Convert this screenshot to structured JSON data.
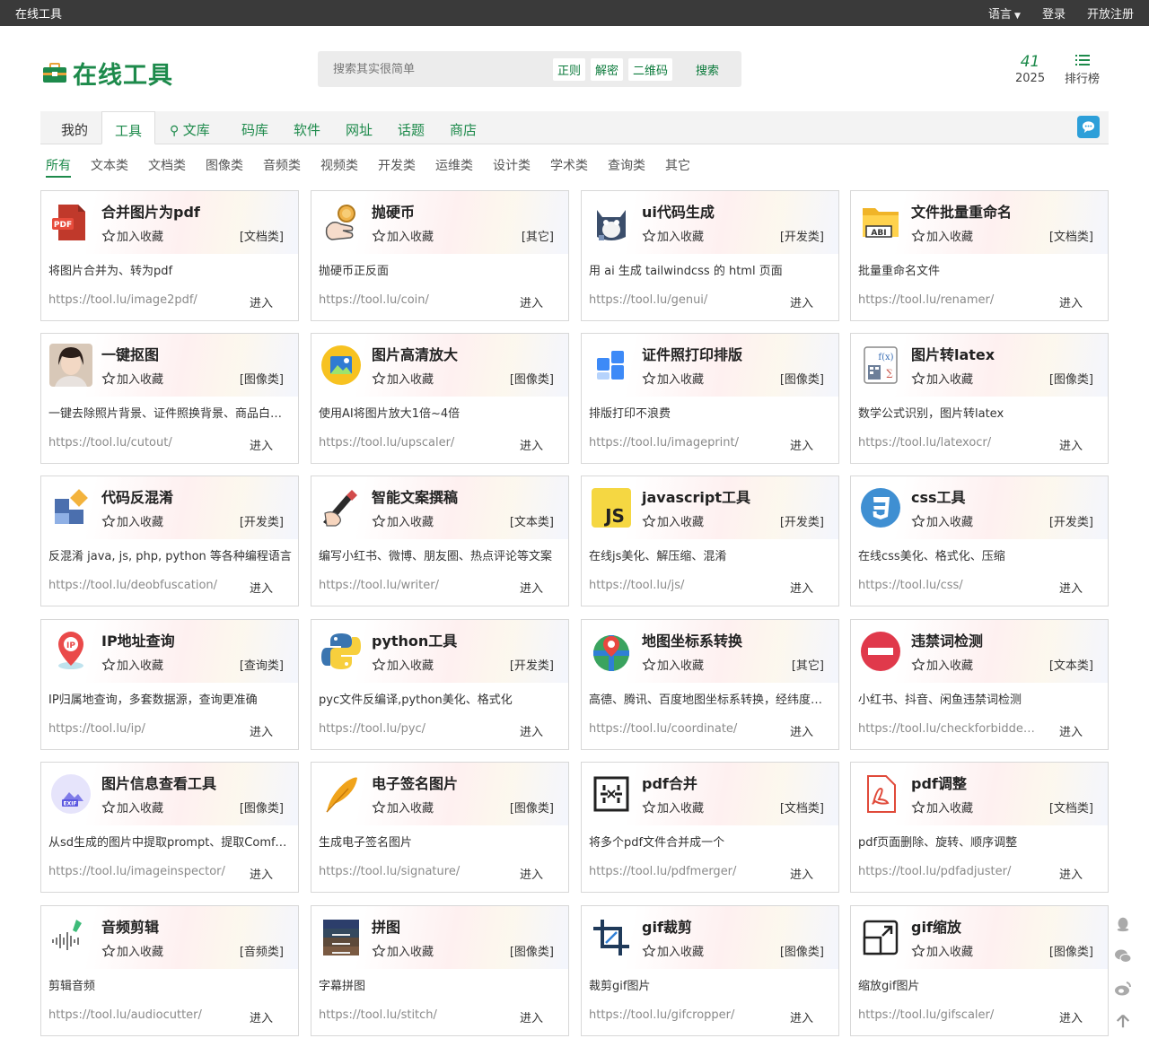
{
  "topbar": {
    "brand": "在线工具",
    "language": "语言",
    "login": "登录",
    "register": "开放注册"
  },
  "header": {
    "logo_text": "在线工具",
    "search_placeholder": "搜索其实很简单",
    "search_tags": [
      "正则",
      "解密",
      "二维码"
    ],
    "search_button": "搜索",
    "stat_count": "41",
    "stat_year": "2025",
    "rank_label": "排行榜"
  },
  "nav": {
    "tabs": [
      "我的",
      "工具",
      "文库",
      "码库",
      "软件",
      "网址",
      "话题",
      "商店"
    ],
    "active": "工具"
  },
  "categories": [
    "所有",
    "文本类",
    "文档类",
    "图像类",
    "音频类",
    "视频类",
    "开发类",
    "运维类",
    "设计类",
    "学术类",
    "查询类",
    "其它"
  ],
  "fav_label": "加入收藏",
  "enter_label": "进入",
  "tools": [
    {
      "name": "合并图片为pdf",
      "category": "[文档类]",
      "desc": "将图片合并为、转为pdf",
      "url": "https://tool.lu/image2pdf/",
      "icon": "pdf-red-icon"
    },
    {
      "name": "抛硬币",
      "category": "[其它]",
      "desc": "抛硬币正反面",
      "url": "https://tool.lu/coin/",
      "icon": "coin-flip-icon"
    },
    {
      "name": "ui代码生成",
      "category": "[开发类]",
      "desc": "用 ai 生成 tailwindcss 的 html 页面",
      "url": "https://tool.lu/genui/",
      "icon": "robot-cat-icon"
    },
    {
      "name": "文件批量重命名",
      "category": "[文档类]",
      "desc": "批量重命名文件",
      "url": "https://tool.lu/renamer/",
      "icon": "folder-rename-icon"
    },
    {
      "name": "一键抠图",
      "category": "[图像类]",
      "desc": "一键去除照片背景、证件照换背景、商品白底图",
      "url": "https://tool.lu/cutout/",
      "icon": "portrait-icon"
    },
    {
      "name": "图片高清放大",
      "category": "[图像类]",
      "desc": "使用AI将图片放大1倍~4倍",
      "url": "https://tool.lu/upscaler/",
      "icon": "image-upscale-icon"
    },
    {
      "name": "证件照打印排版",
      "category": "[图像类]",
      "desc": "排版打印不浪费",
      "url": "https://tool.lu/imageprint/",
      "icon": "blue-squares-icon"
    },
    {
      "name": "图片转latex",
      "category": "[图像类]",
      "desc": "数学公式识别，图片转latex",
      "url": "https://tool.lu/latexocr/",
      "icon": "formula-icon"
    },
    {
      "name": "代码反混淆",
      "category": "[开发类]",
      "desc": "反混淆 java, js, php, python 等各种编程语言",
      "url": "https://tool.lu/deobfuscation/",
      "icon": "puzzle-icon"
    },
    {
      "name": "智能文案撰稿",
      "category": "[文本类]",
      "desc": "编写小红书、微博、朋友圈、热点评论等文案",
      "url": "https://tool.lu/writer/",
      "icon": "pen-hand-icon"
    },
    {
      "name": "javascript工具",
      "category": "[开发类]",
      "desc": "在线js美化、解压缩、混淆",
      "url": "https://tool.lu/js/",
      "icon": "js-icon"
    },
    {
      "name": "css工具",
      "category": "[开发类]",
      "desc": "在线css美化、格式化、压缩",
      "url": "https://tool.lu/css/",
      "icon": "css3-icon"
    },
    {
      "name": "IP地址查询",
      "category": "[查询类]",
      "desc": "IP归属地查询，多套数据源，查询更准确",
      "url": "https://tool.lu/ip/",
      "icon": "ip-pin-icon"
    },
    {
      "name": "python工具",
      "category": "[开发类]",
      "desc": "pyc文件反编译,python美化、格式化",
      "url": "https://tool.lu/pyc/",
      "icon": "python-icon"
    },
    {
      "name": "地图坐标系转换",
      "category": "[其它]",
      "desc": "高德、腾讯、百度地图坐标系转换，经纬度转换",
      "url": "https://tool.lu/coordinate/",
      "icon": "map-pin-icon"
    },
    {
      "name": "违禁词检测",
      "category": "[文本类]",
      "desc": "小红书、抖音、闲鱼违禁词检测",
      "url": "https://tool.lu/checkforbiddenwords/",
      "icon": "forbidden-icon"
    },
    {
      "name": "图片信息查看工具",
      "category": "[图像类]",
      "desc": "从sd生成的图片中提取prompt、提取Comfyui工作流",
      "url": "https://tool.lu/imageinspector/",
      "icon": "exif-icon"
    },
    {
      "name": "电子签名图片",
      "category": "[图像类]",
      "desc": "生成电子签名图片",
      "url": "https://tool.lu/signature/",
      "icon": "feather-icon"
    },
    {
      "name": "pdf合并",
      "category": "[文档类]",
      "desc": "将多个pdf文件合并成一个",
      "url": "https://tool.lu/pdfmerger/",
      "icon": "merge-box-icon"
    },
    {
      "name": "pdf调整",
      "category": "[文档类]",
      "desc": "pdf页面删除、旋转、顺序调整",
      "url": "https://tool.lu/pdfadjuster/",
      "icon": "pdf-outline-icon"
    },
    {
      "name": "音频剪辑",
      "category": "[音频类]",
      "desc": "剪辑音频",
      "url": "https://tool.lu/audiocutter/",
      "icon": "audio-wave-icon"
    },
    {
      "name": "拼图",
      "category": "[图像类]",
      "desc": "字幕拼图",
      "url": "https://tool.lu/stitch/",
      "icon": "photo-stitch-icon"
    },
    {
      "name": "gif裁剪",
      "category": "[图像类]",
      "desc": "裁剪gif图片",
      "url": "https://tool.lu/gifcropper/",
      "icon": "crop-icon"
    },
    {
      "name": "gif缩放",
      "category": "[图像类]",
      "desc": "缩放gif图片",
      "url": "https://tool.lu/gifscaler/",
      "icon": "scale-icon"
    }
  ]
}
